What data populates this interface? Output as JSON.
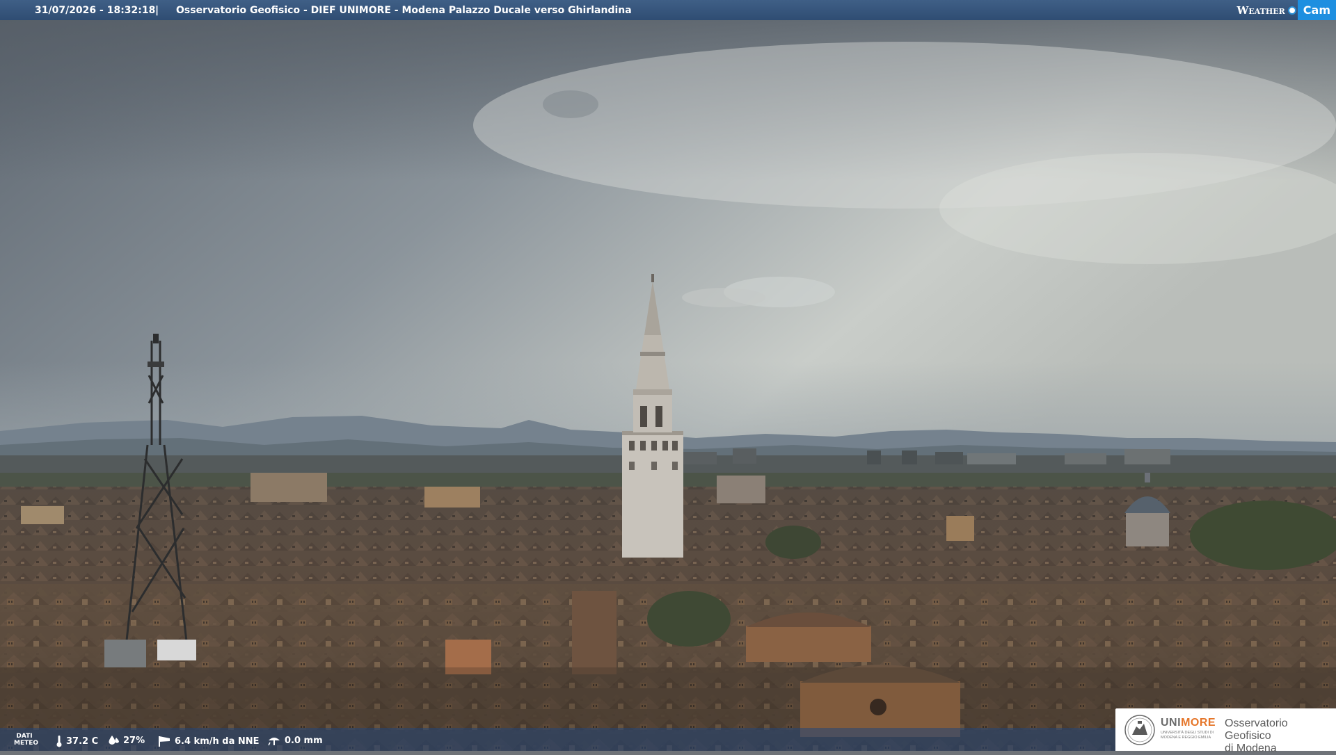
{
  "overlay": {
    "timestamp": "31/07/2026 - 18:32:18",
    "separator": "|",
    "title": "Osservatorio Geofisico - DIEF UNIMORE - Modena Palazzo Ducale verso Ghirlandina",
    "brand_weather": "Weather",
    "brand_cam": "Cam",
    "brand_color": "#1e8fe0"
  },
  "weather": {
    "label_line1": "DATI",
    "label_line2": "METEO",
    "temperature": "37.2 C",
    "humidity": "27%",
    "wind": "6.4 km/h da NNE",
    "rain": "0.0 mm",
    "icons": [
      "thermometer-icon",
      "humidity-drop-icon",
      "wind-sock-icon",
      "rain-gauge-icon"
    ]
  },
  "logo": {
    "uni_part1": "UNI",
    "uni_part2": "MORE",
    "uni_sub": "UNIVERSITÀ DEGLI STUDI DI MODENA E REGGIO EMILIA",
    "obs_line1": "Osservatorio Geofisico",
    "obs_line2": "di Modena",
    "accent": "#e5762a"
  }
}
